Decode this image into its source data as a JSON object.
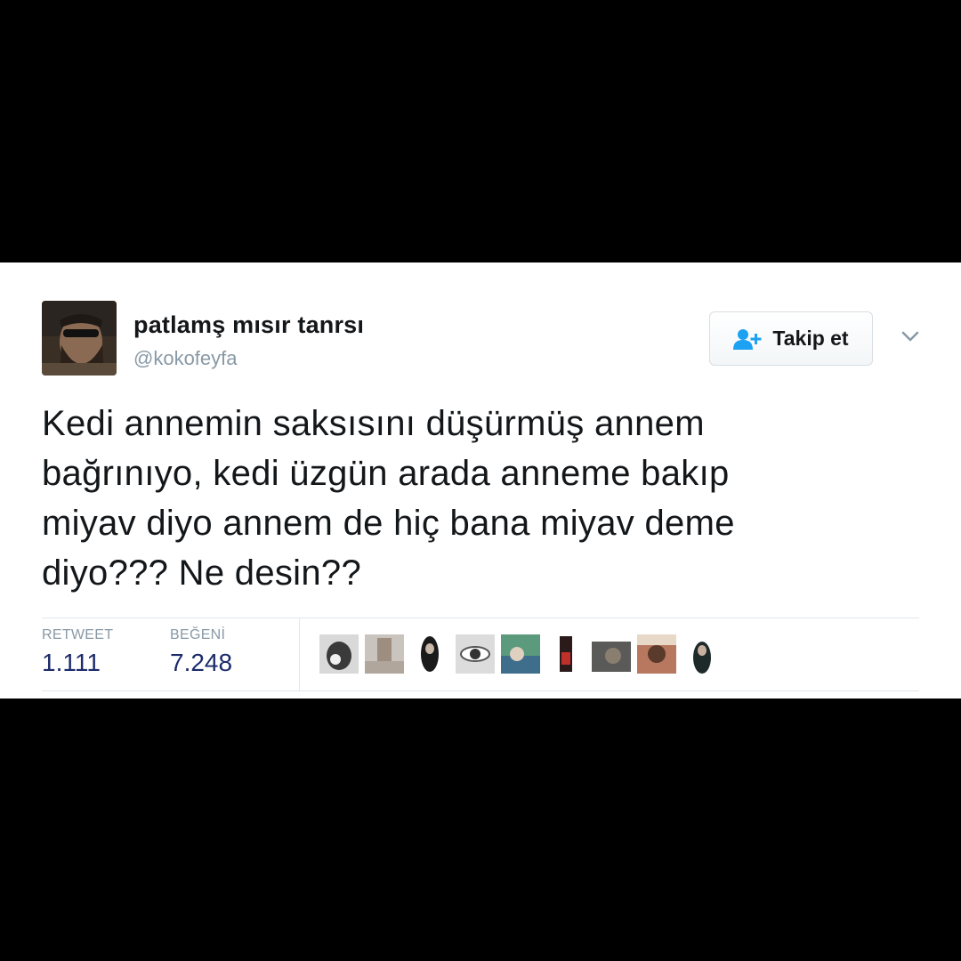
{
  "tweet": {
    "author": {
      "display_name": "patlamş mısır tanrsı",
      "handle": "@kokofeyfa",
      "avatar_icon": "avatar-man-sunglasses"
    },
    "follow_button": {
      "label": "Takip et",
      "icon": "add-user-icon",
      "icon_color": "#1da1f2"
    },
    "menu_icon": "chevron-down-icon",
    "text": "Kedi annemin saksısını düşürmüş annem\nbağrınıyo, kedi üzgün arada anneme bakıp\nmiyav diyo annem de hiç bana miyav deme\ndiyo??? Ne desin??",
    "stats": {
      "retweet_label": "RETWEET",
      "retweet_count": "1.111",
      "like_label": "BEĞENİ",
      "like_count": "7.248"
    },
    "liker_avatars": [
      {
        "name": "liker-avatar-1"
      },
      {
        "name": "liker-avatar-2"
      },
      {
        "name": "liker-avatar-3"
      },
      {
        "name": "liker-avatar-4"
      },
      {
        "name": "liker-avatar-5"
      },
      {
        "name": "liker-avatar-6"
      },
      {
        "name": "liker-avatar-7"
      },
      {
        "name": "liker-avatar-8"
      },
      {
        "name": "liker-avatar-9"
      }
    ]
  },
  "colors": {
    "background": "#000000",
    "card": "#ffffff",
    "text": "#14171a",
    "muted": "#8899a6",
    "count": "#1c2b6b",
    "accent": "#1da1f2"
  }
}
